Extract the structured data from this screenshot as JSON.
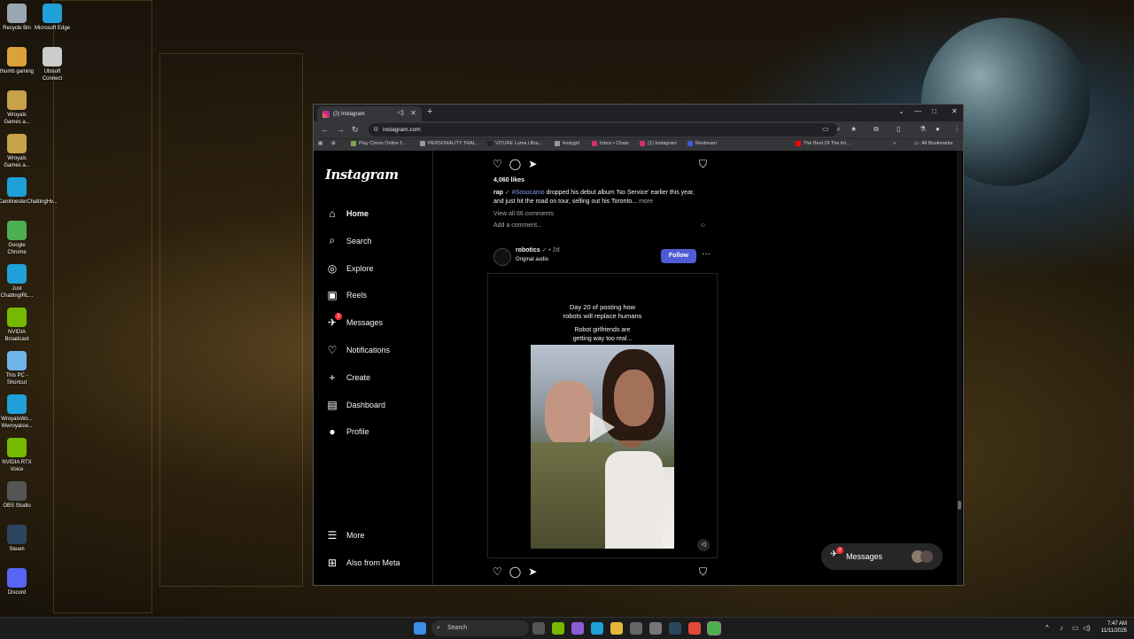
{
  "desktop": {
    "icons": [
      {
        "label": "Recycle Bin",
        "color": "#9aa7b3"
      },
      {
        "label": "Microsoft Edge",
        "color": "#1fa0d8"
      },
      {
        "label": "thumb gaming",
        "color": "#d9a23c"
      },
      {
        "label": "Ubisoft Connect",
        "color": "#cccccc"
      },
      {
        "label": "Wroyals Games a...",
        "color": "#c8a24a"
      },
      {
        "label": "Wroyals Games a...",
        "color": "#c8a24a"
      },
      {
        "label": "CarolinesterChattingHv...",
        "color": "#1fa0d8"
      },
      {
        "label": "Google Chrome",
        "color": "#4caf50"
      },
      {
        "label": "Just ChattingIRL...",
        "color": "#1fa0d8"
      },
      {
        "label": "NVIDIA Broadcast",
        "color": "#76b900"
      },
      {
        "label": "This PC - Shortcut",
        "color": "#6fb4e8"
      },
      {
        "label": "WroyalsWo... Wwroyalsw...",
        "color": "#1fa0d8"
      },
      {
        "label": "NVIDIA RTX Voice",
        "color": "#76b900"
      },
      {
        "label": "OBS Studio",
        "color": "#555555"
      },
      {
        "label": "Steam",
        "color": "#2a475e"
      },
      {
        "label": "Discord",
        "color": "#5865f2"
      }
    ]
  },
  "browser": {
    "tab_title": "(2) Instagram",
    "url": "instagram.com",
    "bookmarks": [
      {
        "label": "Play Chess Online f...",
        "color": "#7fa650"
      },
      {
        "label": "PERSONALITY TRAI...",
        "color": "#999999"
      },
      {
        "label": "VITURE Luma Ultra...",
        "color": "#222222"
      },
      {
        "label": "fentygirl",
        "color": "#999999"
      },
      {
        "label": "Inbox • Chats",
        "color": "#d62976"
      },
      {
        "label": "(1) Instagram",
        "color": "#d62976"
      },
      {
        "label": "Restream",
        "color": "#3b5bdb"
      },
      {
        "label": "The Best Of The Int...",
        "color": "#ff0000"
      }
    ],
    "all_bookmarks": "All Bookmarks"
  },
  "instagram": {
    "logo": "Instagram",
    "nav": [
      {
        "label": "Home",
        "icon": "home-icon",
        "glyph": "⌂"
      },
      {
        "label": "Search",
        "icon": "search-icon",
        "glyph": "⌕"
      },
      {
        "label": "Explore",
        "icon": "compass-icon",
        "glyph": "◎"
      },
      {
        "label": "Reels",
        "icon": "reels-icon",
        "glyph": "▣"
      },
      {
        "label": "Messages",
        "icon": "messenger-icon",
        "glyph": "✈"
      },
      {
        "label": "Notifications",
        "icon": "heart-icon",
        "glyph": "♡"
      },
      {
        "label": "Create",
        "icon": "plus-icon",
        "glyph": "+"
      },
      {
        "label": "Dashboard",
        "icon": "dashboard-icon",
        "glyph": "▤"
      },
      {
        "label": "Profile",
        "icon": "profile-avatar-icon",
        "glyph": "●"
      }
    ],
    "messages_badge": "2",
    "more": "More",
    "meta": "Also from Meta",
    "post1": {
      "likes": "4,060 likes",
      "username": "rap",
      "hashtag": "#Sosocamo",
      "caption": " dropped his debut album 'No Service' earlier this year, and just hit the road on tour, selling out his Toronto...",
      "more": " more",
      "view_comments": "View all 66 comments",
      "add_comment": "Add a comment..."
    },
    "post2": {
      "username": "robotics",
      "time": "• 2d",
      "audio": "Original audio",
      "follow": "Follow",
      "video_line1": "Day 20 of posting how",
      "video_line2": "robots will replace humans",
      "video_line3": "Robot girlfriends are",
      "video_line4": "getting way too real..."
    },
    "messages_pill": "Messages",
    "messages_pill_badge": "2"
  },
  "taskbar": {
    "search": "Search",
    "time": "7:47 AM",
    "date": "11/11/2025"
  }
}
